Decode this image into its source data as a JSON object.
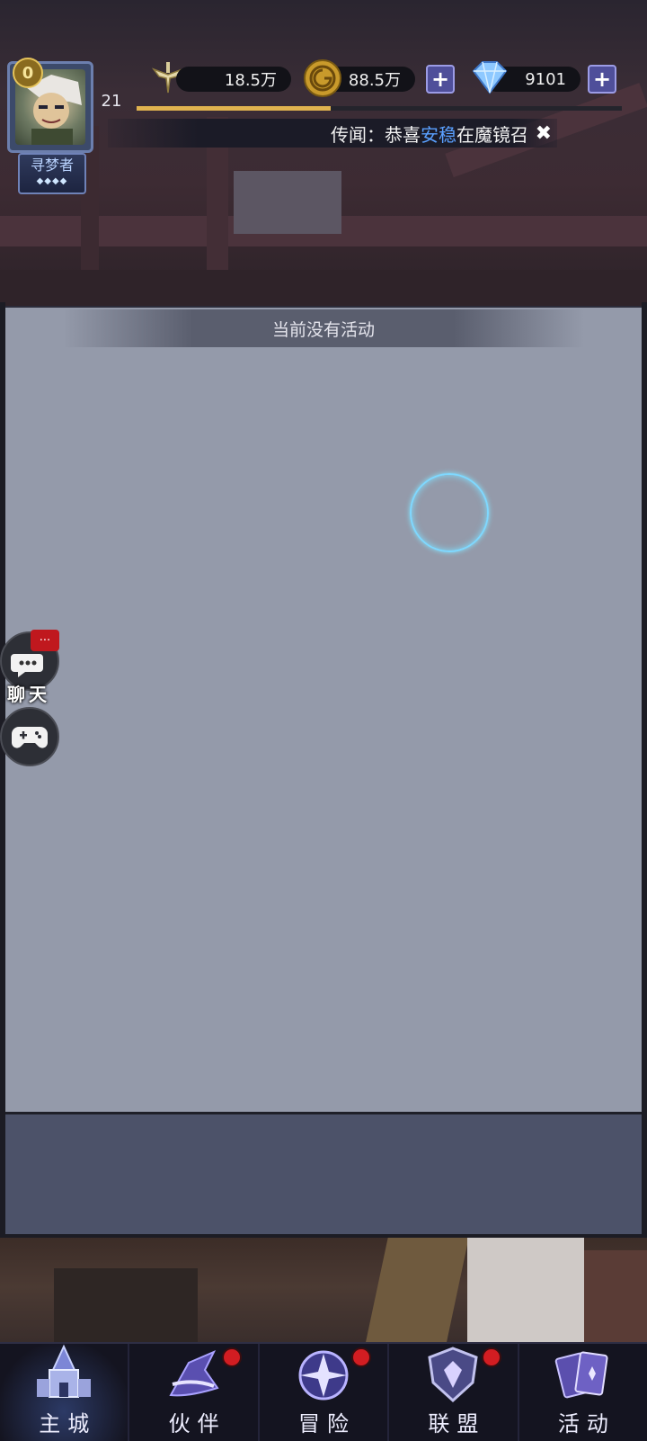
{
  "player": {
    "vip_level": "0",
    "level": "21",
    "title": "寻梦者",
    "title_stars": "◆◆◆◆",
    "xp_progress": 0.4
  },
  "resources": {
    "power": "18.5万",
    "gold": "88.5万",
    "diamonds": "9101"
  },
  "news": {
    "prefix": "传闻：恭喜",
    "player_name": "安稳",
    "suffix": "在魔镜召"
  },
  "panel": {
    "header": "当前没有活动"
  },
  "side": {
    "chat_label": "聊天",
    "chat_badge": "..."
  },
  "nav": {
    "items": [
      {
        "label": "主城",
        "icon": "castle-icon",
        "active": true,
        "badge": false
      },
      {
        "label": "伙伴",
        "icon": "wizard-hat-icon",
        "active": false,
        "badge": true
      },
      {
        "label": "冒险",
        "icon": "compass-icon",
        "active": false,
        "badge": true
      },
      {
        "label": "联盟",
        "icon": "shield-icon",
        "active": false,
        "badge": true
      },
      {
        "label": "活动",
        "icon": "cards-icon",
        "active": false,
        "badge": false
      }
    ]
  },
  "colors": {
    "panel_bg": "#949aaa",
    "xp_fill": "#e0b34f",
    "highlight_name": "#5aa0ff",
    "notification": "#d21d22"
  }
}
